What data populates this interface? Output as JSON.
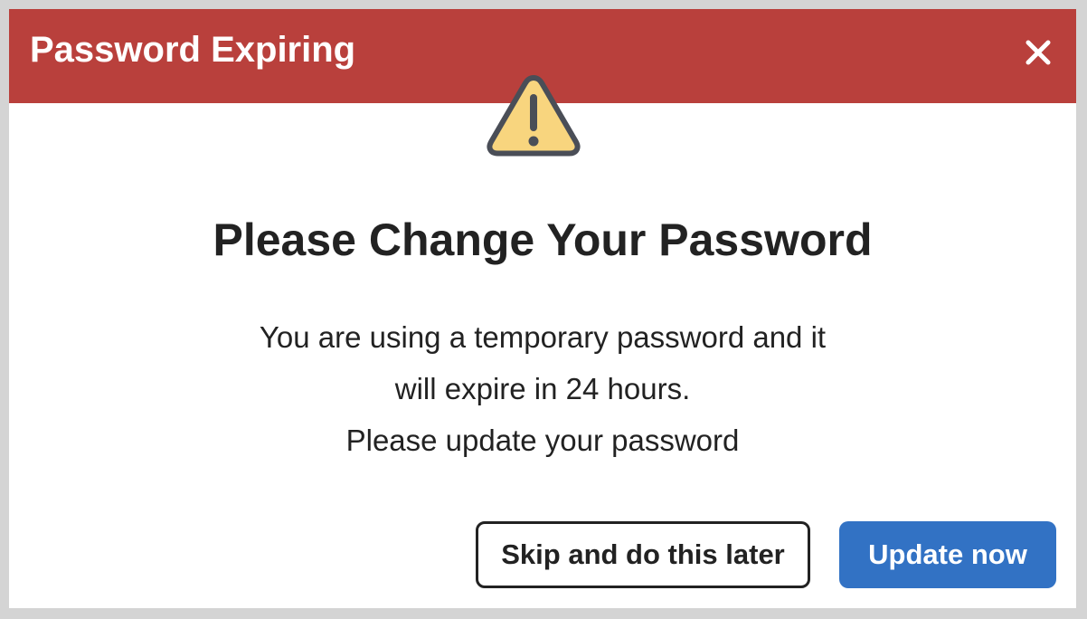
{
  "dialog": {
    "title": "Password Expiring",
    "close_icon": "close-icon",
    "warning_icon": "warning-triangle-icon",
    "heading": "Please Change Your Password",
    "message_lines": [
      "You are using a temporary password and it",
      "will expire in 24 hours.",
      "Please update your password"
    ],
    "secondary_button": "Skip and do this later",
    "primary_button": "Update now"
  },
  "colors": {
    "header_bg": "#b9403c",
    "primary_button_bg": "#3272c4",
    "warning_fill": "#f8d57e",
    "warning_stroke": "#4a4e57"
  }
}
